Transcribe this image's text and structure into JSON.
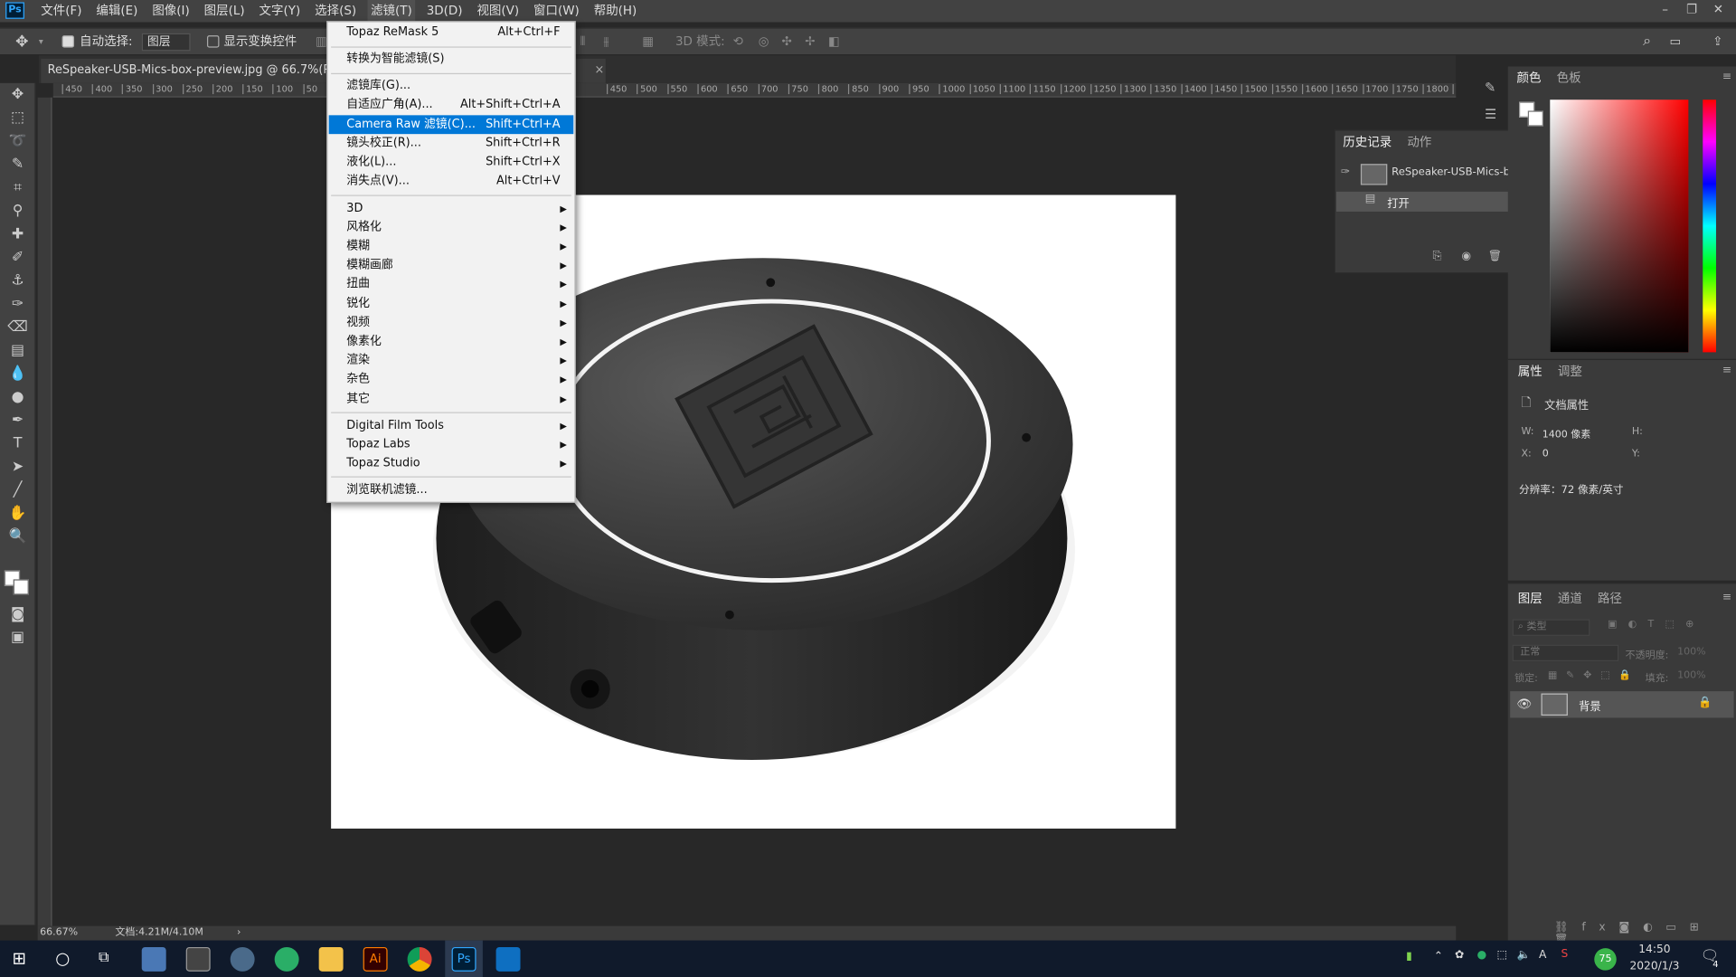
{
  "app": {
    "logo": "Ps"
  },
  "menubar": {
    "items": [
      "文件(F)",
      "编辑(E)",
      "图像(I)",
      "图层(L)",
      "文字(Y)",
      "选择(S)",
      "滤镜(T)",
      "3D(D)",
      "视图(V)",
      "窗口(W)",
      "帮助(H)"
    ],
    "active_index": 6
  },
  "options": {
    "auto_select_label": "自动选择:",
    "auto_select_value": "图层",
    "show_transform_label": "显示变换控件",
    "mode3d_label": "3D 模式:"
  },
  "document": {
    "tab_title": "ReSpeaker-USB-Mics-box-preview.jpg @ 66.7%(RGB/8#)",
    "tab_close": "×",
    "zoom": "66.67%",
    "doc_info": "文档:4.21M/4.10M",
    "status_arrow": "›"
  },
  "ruler": {
    "ticks_left": [
      "450",
      "400",
      "350",
      "300",
      "250",
      "200",
      "150",
      "100",
      "50"
    ],
    "ticks_right": [
      "450",
      "500",
      "550",
      "600",
      "650",
      "700",
      "750",
      "800",
      "850",
      "900",
      "950",
      "1000",
      "1050",
      "1100",
      "1150",
      "1200",
      "1250",
      "1300",
      "1350",
      "1400",
      "1450",
      "1500",
      "1550",
      "1600",
      "1650",
      "1700",
      "1750",
      "1800",
      "1"
    ]
  },
  "filter_menu": {
    "top": [
      {
        "label": "Topaz ReMask 5",
        "shortcut": "Alt+Ctrl+F"
      }
    ],
    "smart": [
      {
        "label": "转换为智能滤镜(S)",
        "shortcut": ""
      }
    ],
    "main": [
      {
        "label": "滤镜库(G)...",
        "shortcut": ""
      },
      {
        "label": "自适应广角(A)...",
        "shortcut": "Alt+Shift+Ctrl+A"
      },
      {
        "label": "Camera Raw 滤镜(C)...",
        "shortcut": "Shift+Ctrl+A"
      },
      {
        "label": "镜头校正(R)...",
        "shortcut": "Shift+Ctrl+R"
      },
      {
        "label": "液化(L)...",
        "shortcut": "Shift+Ctrl+X"
      },
      {
        "label": "消失点(V)...",
        "shortcut": "Alt+Ctrl+V"
      }
    ],
    "submenus": [
      "3D",
      "风格化",
      "模糊",
      "模糊画廊",
      "扭曲",
      "锐化",
      "视频",
      "像素化",
      "渲染",
      "杂色",
      "其它"
    ],
    "plugins": [
      "Digital Film Tools",
      "Topaz Labs",
      "Topaz Studio"
    ],
    "browse": "浏览联机滤镜..."
  },
  "history": {
    "tabs": [
      "历史记录",
      "动作"
    ],
    "snapshot": "ReSpeaker-USB-Mics-b...",
    "step": "打开"
  },
  "color_panel": {
    "tabs": [
      "颜色",
      "色板"
    ]
  },
  "properties": {
    "tabs": [
      "属性",
      "调整"
    ],
    "title": "文档属性",
    "w_label": "W:",
    "w_value": "1400 像素",
    "h_label": "H:",
    "x_label": "X:",
    "x_value": "0",
    "y_label": "Y:",
    "resolution": "分辨率：72 像素/英寸"
  },
  "layers": {
    "tabs": [
      "图层",
      "通道",
      "路径"
    ],
    "filter_placeholder": "类型",
    "blend_mode": "正常",
    "opacity_label": "不透明度:",
    "opacity_value": "100%",
    "lock_label": "锁定:",
    "fill_label": "填充:",
    "fill_value": "100%",
    "layer_name": "背景"
  },
  "taskbar": {
    "time": "14:50",
    "date": "2020/1/3",
    "badge": "75",
    "notify_count": "4",
    "ime": "A"
  },
  "colors": {
    "accent": "#0078d7",
    "ps_blue": "#31a8ff"
  }
}
